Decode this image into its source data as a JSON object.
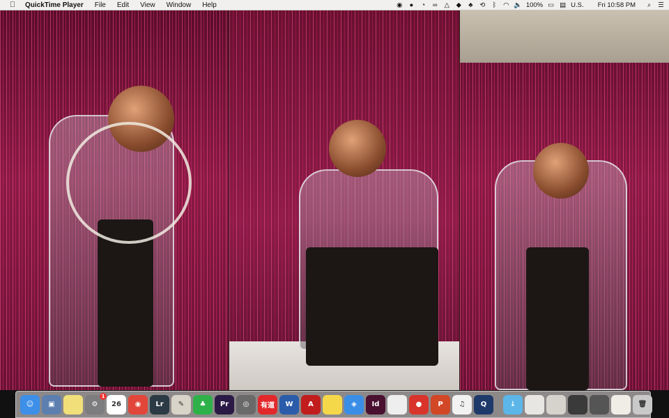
{
  "menubar": {
    "app_name": "QuickTime Player",
    "menus": [
      "File",
      "Edit",
      "View",
      "Window",
      "Help"
    ],
    "battery": "100%",
    "input_source": "U.S.",
    "clock": "Fri 10:58 PM"
  },
  "dock": {
    "items": [
      {
        "name": "Finder",
        "icon": "finder-icon",
        "glyph": "☺",
        "color": "#3d8fe8"
      },
      {
        "name": "Preview",
        "icon": "preview-icon",
        "glyph": "▣",
        "color": "#5c7fb0"
      },
      {
        "name": "Stickies",
        "icon": "stickies-icon",
        "glyph": "",
        "color": "#f1e07a"
      },
      {
        "name": "System Preferences",
        "icon": "system-preferences-icon",
        "glyph": "⚙",
        "color": "#7d7d80",
        "badge": "1"
      },
      {
        "name": "Calendar",
        "icon": "calendar-icon",
        "glyph": "26",
        "color": "#ffffff"
      },
      {
        "name": "Chrome",
        "icon": "chrome-icon",
        "glyph": "◉",
        "color": "#e2463a"
      },
      {
        "name": "Lightroom",
        "icon": "lightroom-icon",
        "glyph": "Lr",
        "color": "#2b3a44"
      },
      {
        "name": "Script Editor",
        "icon": "script-editor-icon",
        "glyph": "✎",
        "color": "#d9d4c8"
      },
      {
        "name": "Evernote",
        "icon": "evernote-icon",
        "glyph": "♣",
        "color": "#2fb14a"
      },
      {
        "name": "Premiere Pro",
        "icon": "premiere-icon",
        "glyph": "Pr",
        "color": "#2b1a45"
      },
      {
        "name": "Disk Utility",
        "icon": "disk-utility-icon",
        "glyph": "◎",
        "color": "#6a6a6a"
      },
      {
        "name": "Youdao Dictionary",
        "icon": "youdao-icon",
        "glyph": "有道",
        "color": "#e2282b"
      },
      {
        "name": "Word",
        "icon": "word-icon",
        "glyph": "W",
        "color": "#2a5caa"
      },
      {
        "name": "Acrobat",
        "icon": "acrobat-icon",
        "glyph": "A",
        "color": "#c11d1d"
      },
      {
        "name": "Notes",
        "icon": "notes-icon",
        "glyph": "",
        "color": "#f5d84a"
      },
      {
        "name": "Safari",
        "icon": "safari-icon",
        "glyph": "◈",
        "color": "#3a8ee6"
      },
      {
        "name": "InDesign",
        "icon": "indesign-icon",
        "glyph": "Id",
        "color": "#4a1030"
      },
      {
        "name": "TextEdit",
        "icon": "textedit-icon",
        "glyph": "",
        "color": "#eeeeee"
      },
      {
        "name": "Voice Memos",
        "icon": "voice-memos-icon",
        "glyph": "●",
        "color": "#d9342b"
      },
      {
        "name": "PowerPoint",
        "icon": "powerpoint-icon",
        "glyph": "P",
        "color": "#d24726"
      },
      {
        "name": "iTunes",
        "icon": "itunes-icon",
        "glyph": "♫",
        "color": "#f2f2f2"
      },
      {
        "name": "QuickTime Player",
        "icon": "quicktime-icon",
        "glyph": "Q",
        "color": "#1e3a6a"
      }
    ],
    "stacks": [
      {
        "name": "Downloads",
        "icon": "downloads-folder-icon",
        "glyph": "↓",
        "color": "#5cb6e8"
      },
      {
        "name": "Screenshot 1",
        "icon": "screenshot-thumb-icon",
        "glyph": "",
        "color": "#e8e6e2"
      },
      {
        "name": "Screenshot 2",
        "icon": "screenshot-thumb-icon",
        "glyph": "",
        "color": "#d6d2cc"
      },
      {
        "name": "Window 1",
        "icon": "window-thumb-icon",
        "glyph": "",
        "color": "#3a3a3a"
      },
      {
        "name": "Window 2",
        "icon": "window-thumb-icon",
        "glyph": "",
        "color": "#555"
      },
      {
        "name": "Document",
        "icon": "document-thumb-icon",
        "glyph": "",
        "color": "#f0ece6"
      },
      {
        "name": "Trash",
        "icon": "trash-icon",
        "glyph": "🗑",
        "color": "#c9c9c9"
      }
    ]
  }
}
